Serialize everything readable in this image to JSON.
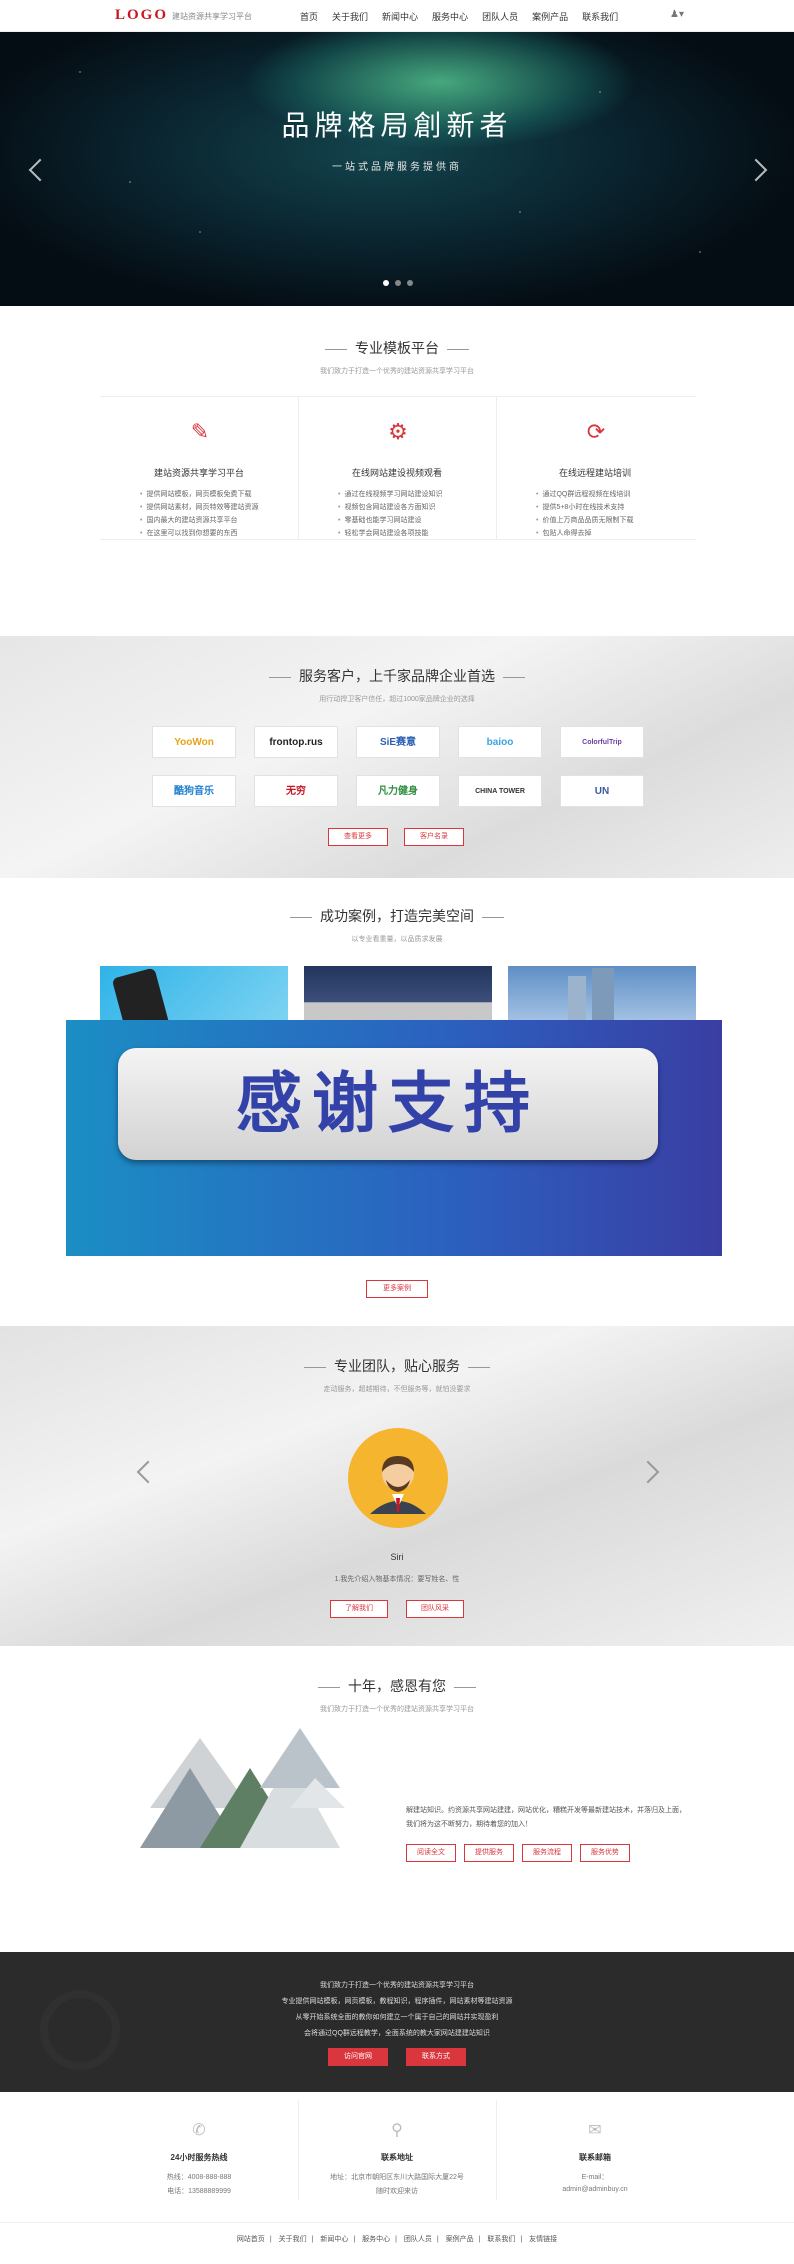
{
  "header": {
    "logo": "LOGO",
    "tagline": "建站资源共享学习平台",
    "nav": [
      "首页",
      "关于我们",
      "新闻中心",
      "服务中心",
      "团队人员",
      "案例产品",
      "联系我们"
    ],
    "user_glyph": "♟▾"
  },
  "banner": {
    "title": "品牌格局創新者",
    "subtitle": "一站式品牌服务提供商"
  },
  "platform": {
    "title": "专业模板平台",
    "subtitle": "我们致力于打造一个优秀的建站资源共享学习平台",
    "cols": [
      {
        "icon": "edit-icon",
        "title": "建站资源共享学习平台",
        "items": [
          "提供网站模板，网页模板免费下载",
          "提供网站素材，网页特效等建站资源",
          "国内最大的建站资源共享平台",
          "在这里可以找到你想要的东西"
        ]
      },
      {
        "icon": "gear-icon",
        "title": "在线网站建设视频观看",
        "items": [
          "通过在线视频学习网站建设知识",
          "视频包含网站建设各方面知识",
          "零基础也能学习网站建设",
          "轻松学会网站建设各项技能"
        ]
      },
      {
        "icon": "refresh-icon",
        "title": "在线远程建站培训",
        "items": [
          "通过QQ群远程视频在线培训",
          "提供5+8小时在线技术支持",
          "价值上万商品品质无限制下载",
          "包贴人命得去掉"
        ]
      }
    ]
  },
  "clients": {
    "title": "服务客户，上千家品牌企业首选",
    "subtitle": "用行动捍卫客户信任，超过1000家品牌企业的选择",
    "logos": [
      "YooWon",
      "frontop.rus",
      "SiE赛意",
      "baioo",
      "ColorfulTrip",
      "酷狗音乐",
      "无穷",
      "凡力健身",
      "CHINA TOWER",
      "UN"
    ],
    "more": "查看更多",
    "list": "客户名录"
  },
  "cases": {
    "title": "成功案例，打造完美空间",
    "subtitle": "以专业看重量，以品质求发展",
    "overlay": "感谢支持",
    "more": "更多案例"
  },
  "team": {
    "title": "专业团队，贴心服务",
    "subtitle": "走动服务，超越期待，不但服务等，就怕没要求",
    "name": "Siri",
    "intro": "1.我先介绍入物基本情况：要写姓名、性",
    "btn_know": "了解我们",
    "btn_team": "团队风采"
  },
  "tenyears": {
    "title": "十年，感恩有您",
    "subtitle": "我们致力于打造一个优秀的建站资源共享学习平台",
    "text1": "解建站知识。约资源共享网站建建，网站优化，糟糕开发等最新建站技术，并落归及上面，",
    "text2": "我们将为这不断努力，期待着您的加入！",
    "tags": [
      "阅读全文",
      "提供服务",
      "服务流程",
      "服务优势"
    ]
  },
  "footer_dark": {
    "lines": [
      "我们致力于打造一个优秀的建站资源共享学习平台",
      "专业提供网站模板，网页模板，教程知识，程序插件，网站素材等建站资源",
      "从零开始系统全面的教你如何建立一个属于自己的网站并实现盈利",
      "会将通过QQ群远程教学，全面系统的教大家网站建建站知识"
    ],
    "btn_site": "访问官网",
    "btn_contact": "联系方式"
  },
  "contacts": [
    {
      "title": "24小时服务热线",
      "lines": [
        "热线：4008-888-888",
        "电话：13588889999"
      ]
    },
    {
      "title": "联系地址",
      "lines": [
        "地址：北京市朝阳区东川大路国际大厦22号",
        "随时欢迎来访"
      ]
    },
    {
      "title": "联系邮箱",
      "lines": [
        "E-mail：",
        "admin@adminbuy.cn"
      ]
    }
  ],
  "bottom_links": [
    "网站首页",
    "关于我们",
    "新闻中心",
    "服务中心",
    "团队人员",
    "案例产品",
    "联系我们",
    "友情链接"
  ]
}
